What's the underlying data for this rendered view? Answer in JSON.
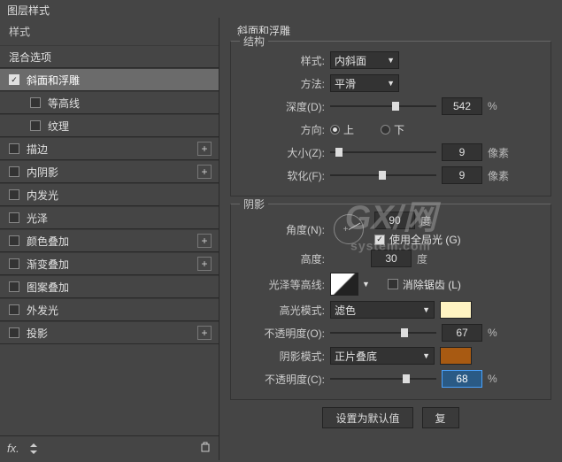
{
  "title": "图层样式",
  "sidebar": {
    "styles_label": "样式",
    "blend_options_label": "混合选项",
    "items": [
      {
        "label": "斜面和浮雕",
        "checked": true,
        "selected": true,
        "plus": false
      },
      {
        "label": "等高线",
        "checked": false,
        "sub": true
      },
      {
        "label": "纹理",
        "checked": false,
        "sub": true
      },
      {
        "label": "描边",
        "checked": false,
        "plus": true
      },
      {
        "label": "内阴影",
        "checked": false,
        "plus": true
      },
      {
        "label": "内发光",
        "checked": false
      },
      {
        "label": "光泽",
        "checked": false
      },
      {
        "label": "颜色叠加",
        "checked": false,
        "plus": true
      },
      {
        "label": "渐变叠加",
        "checked": false,
        "plus": true
      },
      {
        "label": "图案叠加",
        "checked": false
      },
      {
        "label": "外发光",
        "checked": false
      },
      {
        "label": "投影",
        "checked": false,
        "plus": true
      }
    ],
    "fx_label": "fx"
  },
  "main": {
    "panel_title": "斜面和浮雕",
    "structure": {
      "group_label": "结构",
      "style_label": "样式:",
      "style_value": "内斜面",
      "technique_label": "方法:",
      "technique_value": "平滑",
      "depth_label": "深度(D):",
      "depth_value": "542",
      "depth_unit": "%",
      "direction_label": "方向:",
      "direction_up": "上",
      "direction_down": "下",
      "size_label": "大小(Z):",
      "size_value": "9",
      "size_unit": "像素",
      "soften_label": "软化(F):",
      "soften_value": "9",
      "soften_unit": "像素"
    },
    "shading": {
      "group_label": "阴影",
      "angle_label": "角度(N):",
      "angle_value": "90",
      "angle_unit": "度",
      "global_light_label": "使用全局光 (G)",
      "global_light_checked": true,
      "altitude_label": "高度:",
      "altitude_value": "30",
      "altitude_unit": "度",
      "contour_label": "光泽等高线:",
      "antialias_label": "消除锯齿 (L)",
      "antialias_checked": false,
      "highlight_mode_label": "高光模式:",
      "highlight_mode_value": "滤色",
      "highlight_color": "#fff4c2",
      "highlight_opacity_label": "不透明度(O):",
      "highlight_opacity_value": "67",
      "highlight_opacity_unit": "%",
      "shadow_mode_label": "阴影模式:",
      "shadow_mode_value": "正片叠底",
      "shadow_color": "#a85a12",
      "shadow_opacity_label": "不透明度(C):",
      "shadow_opacity_value": "68",
      "shadow_opacity_unit": "%"
    },
    "buttons": {
      "default": "设置为默认值",
      "reset": "复"
    }
  },
  "watermark": {
    "big": "GX/网",
    "small": "system.com"
  }
}
